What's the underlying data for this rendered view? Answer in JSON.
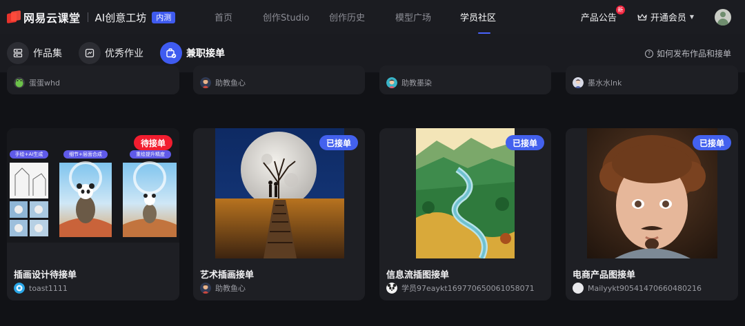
{
  "header": {
    "brand": "网易云课堂",
    "product": "AI创意工坊",
    "beta_label": "内测",
    "nav": [
      {
        "label": "首页"
      },
      {
        "label": "创作Studio"
      },
      {
        "label": "创作历史"
      },
      {
        "label": "模型广场"
      },
      {
        "label": "学员社区"
      }
    ],
    "announcement": "产品公告",
    "new_badge": "新",
    "vip": "开通会员"
  },
  "subnav": {
    "tabs": [
      {
        "label": "作品集",
        "icon": "collection-icon"
      },
      {
        "label": "优秀作业",
        "icon": "homework-icon"
      },
      {
        "label": "兼职接单",
        "icon": "job-order-icon"
      }
    ],
    "active_tab": "兼职接单",
    "help": "如何发布作品和接单"
  },
  "colors": {
    "accent": "#3f5bf0",
    "badge_open": "#f21d2f",
    "badge_taken": "#4361ee"
  },
  "row1": [
    {
      "author": "蛋蛋whd"
    },
    {
      "author": "助教鱼心"
    },
    {
      "author": "助教墨染"
    },
    {
      "author": "墨水水lnk"
    }
  ],
  "row2": [
    {
      "title": "插画设计待接单",
      "status": "待接单",
      "author": "toast1111",
      "labels": [
        "手绘+AI生成",
        "细节+层面合成",
        "重绘提升精度"
      ]
    },
    {
      "title": "艺术插画接单",
      "status": "已接单",
      "author": "助教鱼心"
    },
    {
      "title": "信息流插图接单",
      "status": "已接单",
      "author": "学员97eaykt1697706500610580​71"
    },
    {
      "title": "电商产品图接单",
      "status": "已接单",
      "author": "Mailyykt90541470660480216"
    }
  ]
}
